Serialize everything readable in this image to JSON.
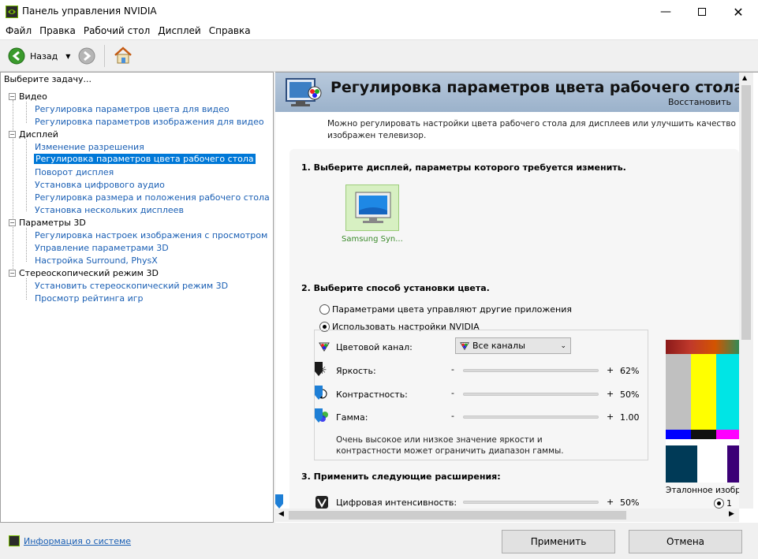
{
  "window": {
    "title": "Панель управления NVIDIA"
  },
  "menu": [
    "Файл",
    "Правка",
    "Рабочий стол",
    "Дисплей",
    "Справка"
  ],
  "toolbar": {
    "back_label": "Назад"
  },
  "left": {
    "header": "Выберите задачу...",
    "categories": [
      {
        "label": "Видео",
        "items": [
          "Регулировка параметров цвета для видео",
          "Регулировка параметров изображения для видео"
        ]
      },
      {
        "label": "Дисплей",
        "items": [
          "Изменение разрешения",
          "Регулировка параметров цвета рабочего стола",
          "Поворот дисплея",
          "Установка цифрового аудио",
          "Регулировка размера и положения рабочего стола",
          "Установка нескольких дисплеев"
        ]
      },
      {
        "label": "Параметры 3D",
        "items": [
          "Регулировка настроек изображения с просмотром",
          "Управление параметрами 3D",
          "Настройка Surround, PhysX"
        ]
      },
      {
        "label": "Стереоскопический режим 3D",
        "items": [
          "Установить стереоскопический режим 3D",
          "Просмотр рейтинга игр"
        ]
      }
    ],
    "selected": "Регулировка параметров цвета рабочего стола"
  },
  "right": {
    "title": "Регулировка параметров цвета рабочего стола",
    "restore": "Восстановить",
    "description": "Можно регулировать настройки цвета рабочего стола для дисплеев или улучшить качество изображен телевизор.",
    "step1": "1. Выберите дисплей, параметры которого требуется изменить.",
    "display_name": "Samsung Syn...",
    "step2": "2. Выберите способ установки цвета.",
    "radio_other": "Параметрами цвета управляют другие приложения",
    "radio_nvidia": "Использовать настройки NVIDIA",
    "channel_label": "Цветовой канал:",
    "channel_value": "Все каналы",
    "brightness_label": "Яркость:",
    "brightness_value": "62%",
    "brightness_level": 0.62,
    "contrast_label": "Контрастность:",
    "contrast_value": "50%",
    "contrast_level": 0.5,
    "gamma_label": "Гамма:",
    "gamma_value": "1.00",
    "gamma_level": 0.3,
    "warning": "Очень высокое или низкое значение яркости и контрастности может ограничить диапазон гаммы.",
    "step3": "3. Применить следующие расширения:",
    "vibrance_label": "Цифровая интенсивность:",
    "vibrance_value": "50%",
    "vibrance_level": 0.5,
    "minus": "-",
    "plus": "+",
    "reference_label": "Эталонное изобра",
    "reference_option": "1"
  },
  "footer": {
    "sysinfo": "Информация о системе",
    "apply": "Применить",
    "cancel": "Отмена"
  },
  "colors": {
    "accent": "#0078d7",
    "nvidia_green": "#76b900",
    "link": "#1a5fb4"
  }
}
